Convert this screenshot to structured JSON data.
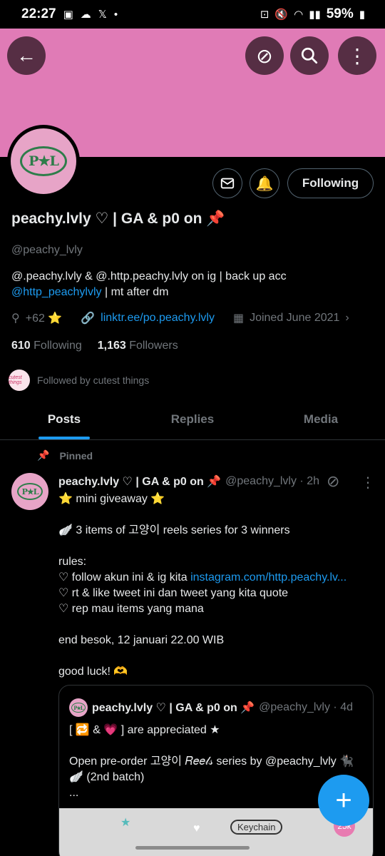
{
  "status": {
    "time": "22:27",
    "left_icons": [
      "gallery-icon",
      "cloud-icon",
      "x-icon",
      "dot-icon"
    ],
    "battery": "59%"
  },
  "colors": {
    "banner": "#e07bb6",
    "accent": "#1d9bf0",
    "avatar_bg": "#e7a4c7",
    "logo": "#2e7d4a"
  },
  "profile": {
    "logo_text": "P★L",
    "follow_label": "Following",
    "display_name": "peachy.lvly ♡ | GA & p0 on 📌",
    "handle": "@peachy_lvly",
    "bio_line1": "@.peachy.lvly & @.http.peachy.lvly on ig | back up acc",
    "bio_link": "@http_peachylvly",
    "bio_tail": " | mt after dm",
    "location": "+62 ⭐",
    "website": "linktr.ee/po.peachy.lvly",
    "joined": "Joined June 2021",
    "following_count": "610",
    "following_label": "Following",
    "followers_count": "1,163",
    "followers_label": "Followers",
    "followed_by": "Followed by cutest things",
    "followed_by_avatar_text": "cutest things"
  },
  "tabs": [
    {
      "label": "Posts"
    },
    {
      "label": "Replies"
    },
    {
      "label": "Media"
    }
  ],
  "tweet": {
    "pinned_label": "Pinned",
    "name": "peachy.lvly ♡ | GA & p0 on 📌",
    "handle_time": "@peachy_lvly · 2h",
    "lines": [
      "⭐ mini giveaway ⭐",
      "",
      "🪽 3 items of 고양이 reels series for 3 winners",
      "",
      "rules:",
      "♡ follow akun ini & ig kita ",
      "♡ rt & like tweet ini dan tweet yang kita quote",
      "♡ rep mau items yang mana",
      "",
      "end besok, 12 januari 22.00 WIB",
      "",
      "good luck! 🫶"
    ],
    "rules_link": "instagram.com/http.peachy.lv...",
    "quote": {
      "name": "peachy.lvly ♡ | GA & p0 on 📌",
      "handle_time": "@peachy_lvly · 4d",
      "lines": [
        "[ 🔁 & 💗 ] are appreciated ★",
        "",
        "Open pre-order 고양이 𝑅𝑒𝑒𝓁𝓈 series by @peachy_lvly 🐈‍⬛",
        "🪽 (2nd batch)",
        "..."
      ],
      "image_label": "Keychain",
      "image_badge": "25k"
    }
  },
  "fab_label": "+"
}
